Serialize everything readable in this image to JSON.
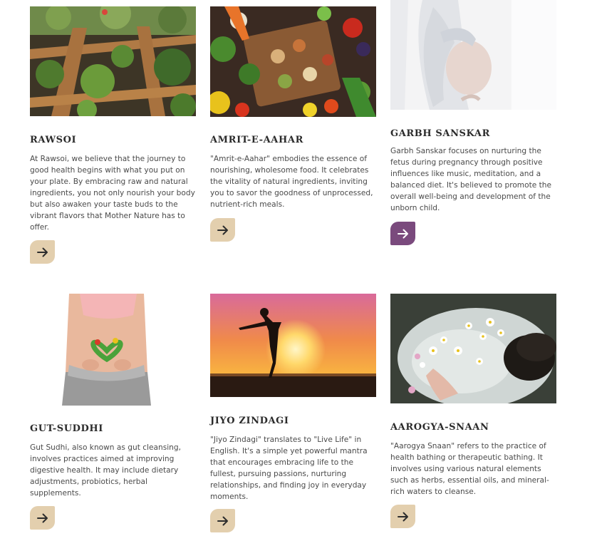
{
  "cards": [
    {
      "title": "RAWSOI",
      "description": "At Rawsoi, we believe that the journey to good health begins with what you put on your plate. By embracing raw and natural ingredients, you not only nourish your body but also awaken your taste buds to the vibrant flavors that Mother Nature has to offer.",
      "image": "raised-garden-beds-photo",
      "button_icon": "arrow-right-icon",
      "button_color": "#e3cfae"
    },
    {
      "title": "AMRIT-E-AAHAR",
      "description": "\"Amrit-e-Aahar\" embodies the essence of nourishing, wholesome food. It celebrates the vitality of natural ingredients, inviting you to savor the goodness of unprocessed, nutrient-rich meals.",
      "image": "fresh-vegetables-and-spices-photo",
      "button_icon": "arrow-right-icon",
      "button_color": "#e3cfae"
    },
    {
      "title": "GARBH SANSKAR",
      "description": "Garbh Sanskar focuses on nurturing the fetus during pregnancy through positive influences like music, meditation, and a balanced diet. It's believed to promote the overall well-being and development of the unborn child.",
      "image": "pregnant-woman-photo",
      "button_icon": "arrow-right-icon",
      "button_color": "#7a4a7d"
    },
    {
      "title": "GUT-SUDDHI",
      "description": "Gut Sudhi, also known as gut cleansing, involves practices aimed at improving digestive health. It may include dietary adjustments, probiotics, herbal supplements.",
      "image": "gut-health-vegetable-heart-photo",
      "button_icon": "arrow-right-icon",
      "button_color": "#e3cfae"
    },
    {
      "title": "JIYO ZINDAGI",
      "description": "\"Jiyo Zindagi\" translates to \"Live Life\" in English. It's a simple yet powerful mantra that encourages embracing life to the fullest, pursuing passions, nurturing relationships, and finding joy in everyday moments.",
      "image": "sunset-silhouette-photo",
      "button_icon": "arrow-right-icon",
      "button_color": "#e3cfae"
    },
    {
      "title": "AAROGYA-SNAAN",
      "description": "\"Aarogya Snaan\" refers to the practice of health bathing or therapeutic bathing. It involves using various natural elements such as herbs, essential oils, and mineral-rich waters to cleanse.",
      "image": "flower-bath-photo",
      "button_icon": "arrow-right-icon",
      "button_color": "#e3cfae"
    }
  ]
}
